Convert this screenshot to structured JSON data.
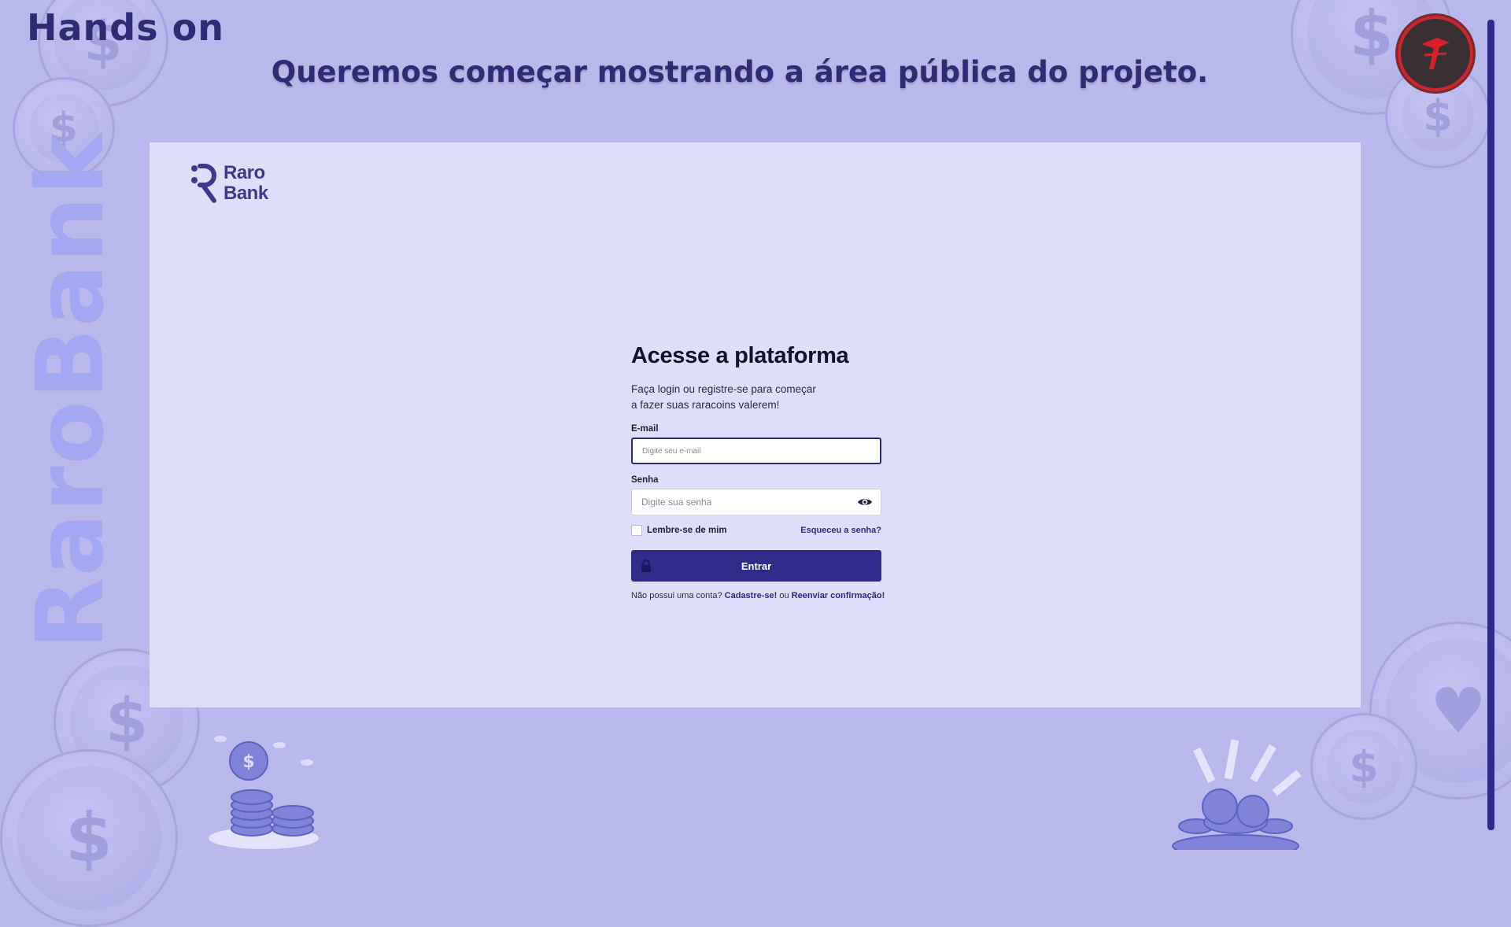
{
  "slide": {
    "title": "Hands on",
    "subtitle": "Queremos começar mostrando a área pública do projeto.",
    "vertical_brand": "RaroBank",
    "colors": {
      "background": "#b9b8ec",
      "heading": "#2f2b75",
      "accent": "#2d2a8c"
    }
  },
  "app": {
    "logo": {
      "line1": "Raro",
      "line2": "Bank"
    },
    "login": {
      "title": "Acesse a plataforma",
      "description": "Faça login ou registre-se para começar a fazer suas raracoins valerem!",
      "email_label": "E-mail",
      "email_placeholder": "Digite seu e-mail",
      "email_value": "",
      "password_label": "Senha",
      "password_placeholder": "Digite sua senha",
      "password_value": "",
      "remember_label": "Lembre-se de mim",
      "remember_checked": false,
      "forgot_label": "Esqueceu a senha?",
      "submit_label": "Entrar",
      "footer_prefix": "Não possui uma conta?",
      "signup_label": "Cadastre-se!",
      "footer_or": "ou",
      "resend_label": "Reenviar confirmação!"
    },
    "icons": [
      "logo-icon",
      "eye-icon",
      "lock-icon"
    ],
    "colors": {
      "primary": "#312c8a",
      "panel": "#dedef8"
    }
  }
}
